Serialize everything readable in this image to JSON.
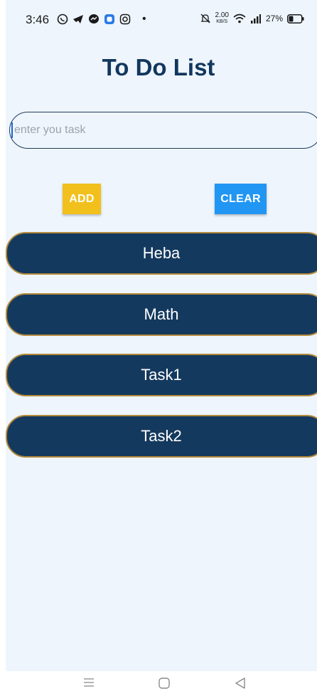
{
  "status_bar": {
    "time": "3:46",
    "net_speed": "2.00",
    "net_unit": "KB/S",
    "battery": "27%",
    "icons": [
      "whatsapp-icon",
      "telegram-icon",
      "messenger-icon",
      "app-icon",
      "instagram-icon",
      "mute-icon",
      "wifi-icon",
      "signal-icon",
      "battery-icon"
    ]
  },
  "app": {
    "title": "To Do List",
    "input_placeholder": "enter you task",
    "add_label": "ADD",
    "clear_label": "CLEAR",
    "tasks": [
      "Heba",
      "Math",
      "Task1",
      "Task2"
    ]
  },
  "colors": {
    "title": "#12375e",
    "task_bg": "#14395e",
    "task_border": "#b48a3c",
    "add_button": "#f2c01c",
    "clear_button": "#2196f3",
    "app_bg": "#eef5fd"
  },
  "nav_bar": {
    "icons": [
      "menu-icon",
      "home-icon",
      "back-icon"
    ]
  }
}
